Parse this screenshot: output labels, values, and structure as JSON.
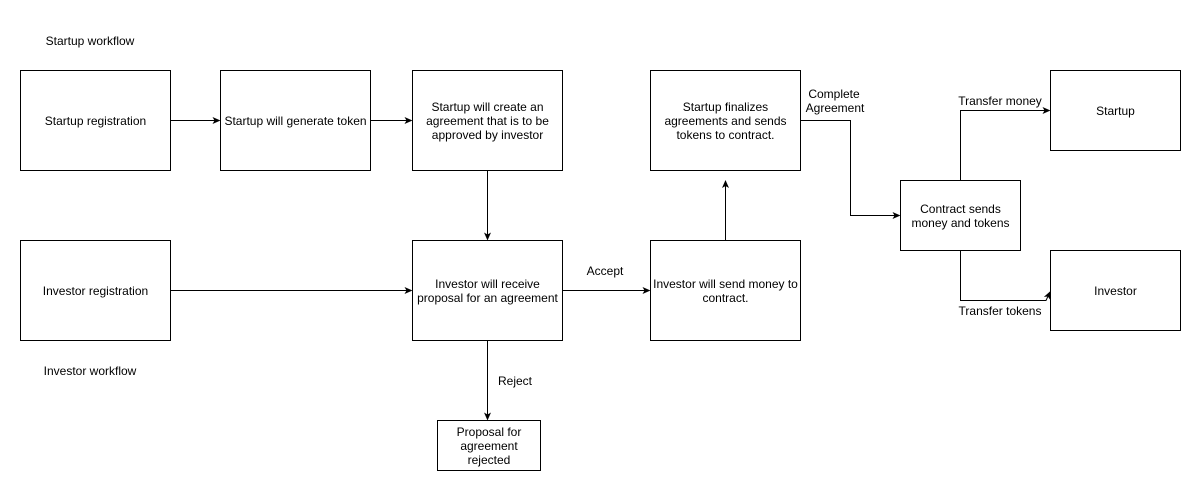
{
  "labels": {
    "startup_workflow": "Startup workflow",
    "investor_workflow": "Investor workflow",
    "accept": "Accept",
    "reject": "Reject",
    "complete_agreement_1": "Complete",
    "complete_agreement_2": "Agreement",
    "transfer_money": "Transfer money",
    "transfer_tokens": "Transfer tokens"
  },
  "nodes": {
    "startup_registration": "Startup registration",
    "generate_token": "Startup will generate token",
    "create_agreement": "Startup will create an agreement that is to be approved by investor",
    "finalize": "Startup finalizes agreements and sends tokens to contract.",
    "investor_registration": "Investor registration",
    "receive_proposal": "Investor will receive proposal for an agreement",
    "send_money": "Investor will send money to contract.",
    "rejected": "Proposal for agreement rejected",
    "contract": "Contract sends money and tokens",
    "startup": "Startup",
    "investor": "Investor"
  },
  "colors": {
    "stroke": "#000000",
    "fill": "#ffffff"
  }
}
